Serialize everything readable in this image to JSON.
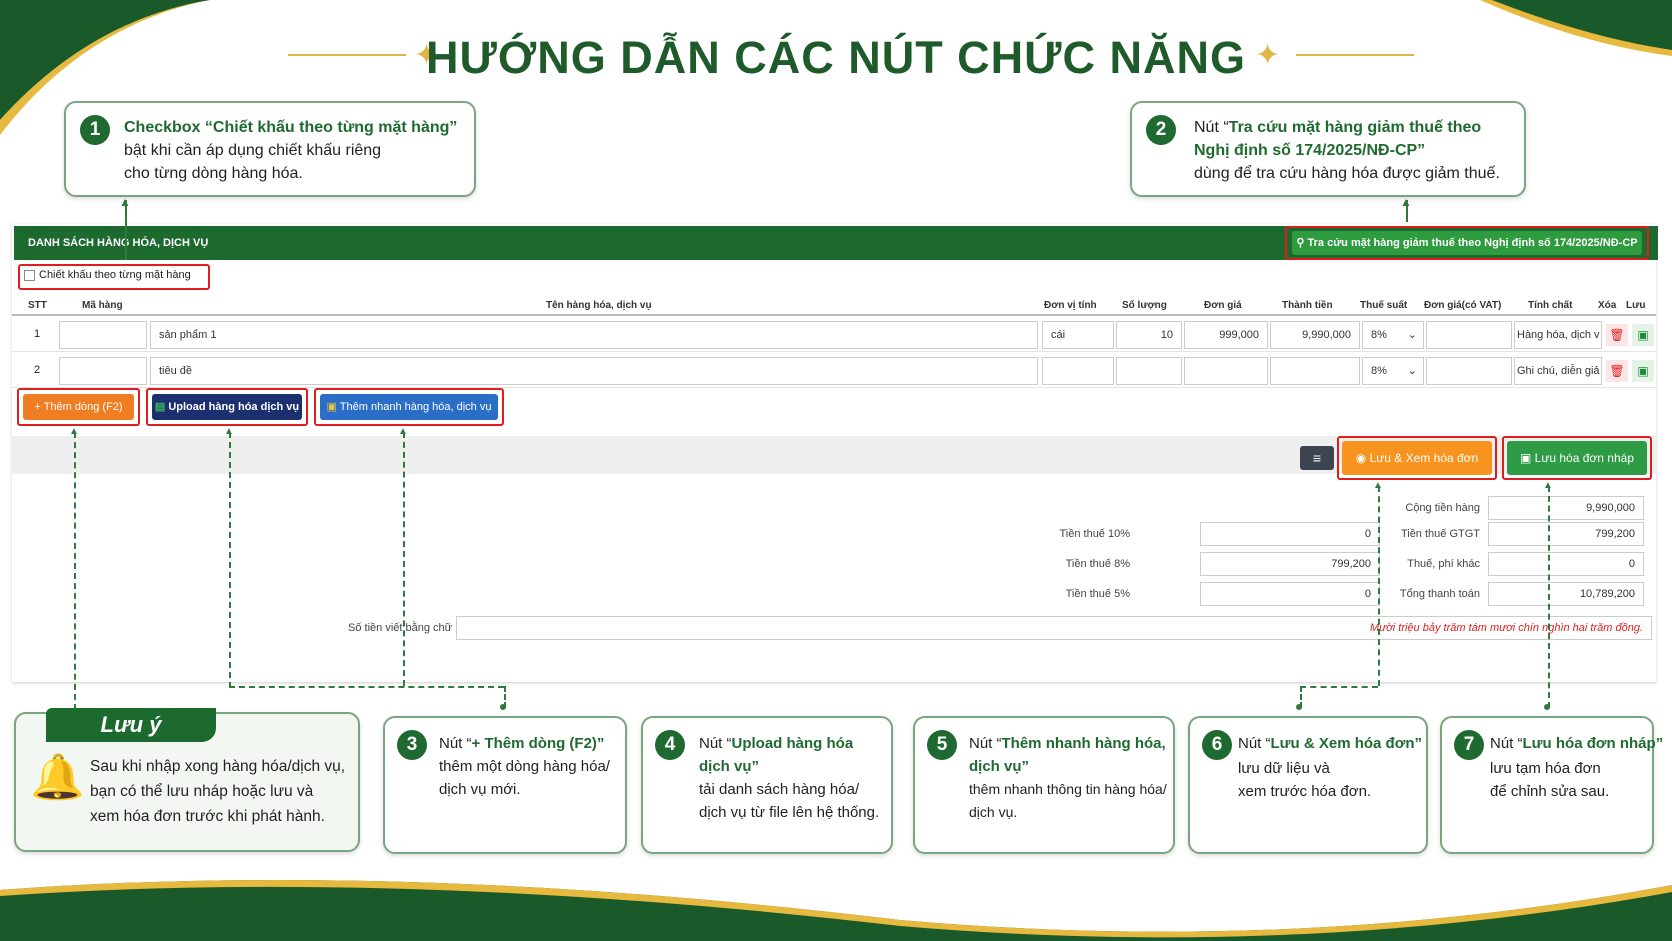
{
  "title": "HƯỚNG DẪN CÁC NÚT CHỨC NĂNG",
  "callouts": {
    "c1": {
      "num": "1",
      "bold": "Checkbox “Chiết khấu theo từng mặt hàng”",
      "line2": "bật khi cần áp dụng chiết khấu riêng",
      "line3": "cho từng dòng hàng hóa."
    },
    "c2": {
      "num": "2",
      "pre": "Nút “",
      "bold1": "Tra cứu mặt hàng giảm thuế theo",
      "bold2": "Nghị định số 174/2025/NĐ-CP”",
      "line3": "dùng để tra cứu hàng hóa được giảm thuế."
    },
    "c3": {
      "num": "3",
      "pre": "Nút “",
      "bold": "+ Thêm dòng (F2)”",
      "line2": "thêm một dòng hàng hóa/",
      "line3": "dịch vụ mới."
    },
    "c4": {
      "num": "4",
      "pre": "Nút “",
      "bold1": "Upload hàng hóa",
      "bold2": "dịch vụ”",
      "line3": "tải danh sách hàng hóa/",
      "line4": "dịch vụ từ file lên hệ thống."
    },
    "c5": {
      "num": "5",
      "pre": "Nút “",
      "bold1": "Thêm nhanh hàng hóa,",
      "bold2": "dịch vụ”",
      "line3": "thêm nhanh thông tin hàng hóa/",
      "line4": "dịch vụ."
    },
    "c6": {
      "num": "6",
      "pre": "Nút “",
      "bold": "Lưu & Xem hóa đơn”",
      "line2": "lưu dữ liệu và",
      "line3": "xem trước hóa đơn."
    },
    "c7": {
      "num": "7",
      "pre": "Nút “",
      "bold": "Lưu hóa đơn nháp”",
      "line2": "lưu tạm hóa đơn",
      "line3": "để chỉnh sửa sau."
    }
  },
  "note": {
    "title": "Lưu ý",
    "line1": "Sau khi nhập xong hàng hóa/dịch vụ,",
    "line2": "bạn có thể lưu nháp hoặc lưu và",
    "line3": "xem hóa đơn trước khi phát hành."
  },
  "app": {
    "section_title": "DANH SÁCH HÀNG HÓA, DỊCH VỤ",
    "lookup_button": "Tra cứu mặt hàng giảm thuế theo Nghị định số 174/2025/NĐ-CP",
    "discount_checkbox": "Chiết khấu theo từng mặt hàng",
    "columns": {
      "stt": "STT",
      "code": "Mã hàng",
      "name": "Tên hàng hóa, dịch vụ",
      "unit": "Đơn vị tính",
      "qty": "Số lượng",
      "price": "Đơn giá",
      "amount": "Thành tiền",
      "tax": "Thuế suất",
      "price_vat": "Đơn giá(có VAT)",
      "nature": "Tính chất",
      "delete": "Xóa",
      "save": "Lưu"
    },
    "rows": [
      {
        "stt": "1",
        "code": "",
        "name": "sản phẩm 1",
        "unit": "cái",
        "qty": "10",
        "price": "999,000",
        "amount": "9,990,000",
        "tax": "8%",
        "price_vat": "",
        "nature": "Hàng hóa, dịch v"
      },
      {
        "stt": "2",
        "code": "",
        "name": "tiêu đề",
        "unit": "",
        "qty": "",
        "price": "",
        "amount": "",
        "tax": "8%",
        "price_vat": "",
        "nature": "Ghi chú, diễn giả"
      }
    ],
    "add_row_button": "Thêm dòng (F2)",
    "upload_button": "Upload hàng hóa dịch vụ",
    "quick_add_button": "Thêm nhanh hàng hóa, dịch vụ",
    "save_view_button": "Lưu & Xem hóa đơn",
    "save_draft_button": "Lưu hóa đơn nháp",
    "totals_left": [
      {
        "label": "Tiền thuế 10%",
        "value": "0"
      },
      {
        "label": "Tiền thuế 8%",
        "value": "799,200"
      },
      {
        "label": "Tiền thuế 5%",
        "value": "0"
      }
    ],
    "totals_right": [
      {
        "label": "Cộng tiền hàng",
        "value": "9,990,000"
      },
      {
        "label": "Tiền thuế GTGT",
        "value": "799,200"
      },
      {
        "label": "Thuế, phí khác",
        "value": "0"
      },
      {
        "label": "Tổng thanh toán",
        "value": "10,789,200"
      }
    ],
    "words_label": "Số tiền viết bằng chữ",
    "words_value": "Mười triệu bảy trăm tám mươi chín nghìn hai trăm đồng."
  },
  "colors": {
    "brand_green": "#1d6a2f",
    "orange": "#f28a1a",
    "navy": "#1c2f6e",
    "blue": "#2a6ec8",
    "red_highlight": "#e01e1e",
    "gold": "#e7b93e"
  }
}
